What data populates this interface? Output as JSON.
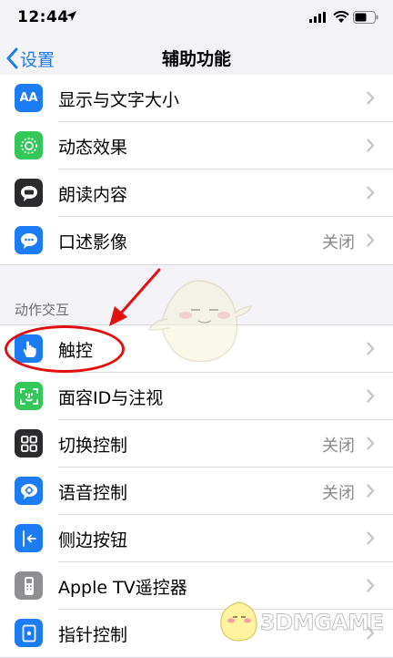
{
  "status_bar": {
    "time": "12:44"
  },
  "nav": {
    "back_label": "设置",
    "title": "辅助功能"
  },
  "group_vision": [
    {
      "icon": "text-size-icon",
      "label": "显示与文字大小",
      "value": ""
    },
    {
      "icon": "motion-icon",
      "label": "动态效果",
      "value": ""
    },
    {
      "icon": "spoken-content-icon",
      "label": "朗读内容",
      "value": ""
    },
    {
      "icon": "audio-description-icon",
      "label": "口述影像",
      "value": "关闭"
    }
  ],
  "section_interaction": "动作交互",
  "group_interaction": [
    {
      "icon": "touch-icon",
      "label": "触控",
      "value": ""
    },
    {
      "icon": "face-id-icon",
      "label": "面容ID与注视",
      "value": ""
    },
    {
      "icon": "switch-control-icon",
      "label": "切换控制",
      "value": "关闭"
    },
    {
      "icon": "voice-control-icon",
      "label": "语音控制",
      "value": "关闭"
    },
    {
      "icon": "side-button-icon",
      "label": "侧边按钮",
      "value": ""
    },
    {
      "icon": "apple-tv-remote-icon",
      "label": "Apple TV遥控器",
      "value": ""
    },
    {
      "icon": "pointer-control-icon",
      "label": "指针控制",
      "value": ""
    }
  ],
  "watermark": {
    "text": "3DMGAME"
  },
  "colors": {
    "accent": "#1b7cf6",
    "annotation": "#e01010"
  }
}
